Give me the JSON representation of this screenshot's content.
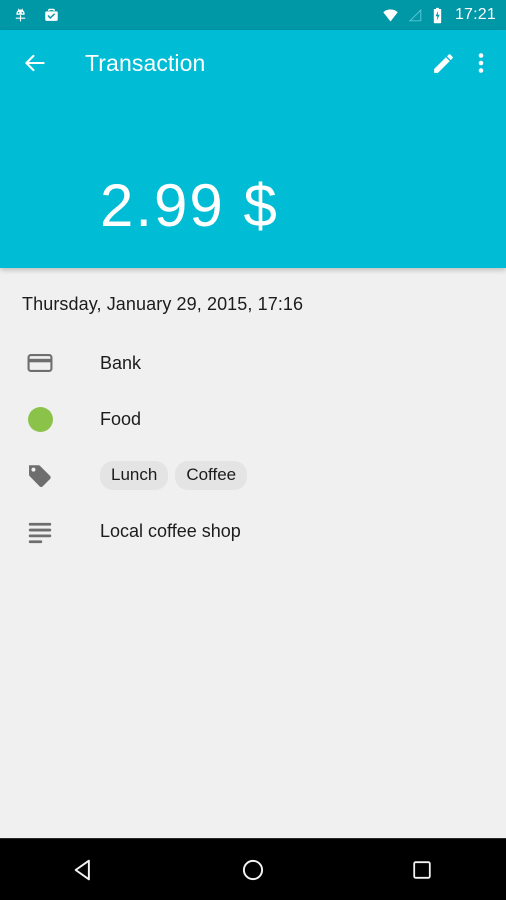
{
  "statusbar": {
    "left_icons": [
      {
        "name": "adb-debug-icon"
      },
      {
        "name": "work-profile-briefcase-icon"
      }
    ],
    "right_icons": [
      {
        "name": "wifi-icon"
      },
      {
        "name": "cellular-signal-icon"
      },
      {
        "name": "battery-charging-icon"
      }
    ],
    "time": "17:21"
  },
  "appbar": {
    "back_icon": "back-arrow-icon",
    "title": "Transaction",
    "edit_icon": "edit-pencil-icon",
    "overflow_icon": "overflow-menu-icon"
  },
  "header": {
    "amount": "2.99 $",
    "background_color": "#00bcd4",
    "statusbar_color": "#0097a7"
  },
  "details": {
    "date": "Thursday, January 29, 2015, 17:16",
    "account": {
      "icon": "credit-card-icon",
      "label": "Bank"
    },
    "category": {
      "icon": "category-color-dot",
      "color": "#8bc34a",
      "label": "Food"
    },
    "tags": {
      "icon": "tag-icon",
      "items": [
        "Lunch",
        "Coffee"
      ]
    },
    "note": {
      "icon": "notes-icon",
      "label": "Local coffee shop"
    }
  },
  "navbar": {
    "back_label": "back-triangle-icon",
    "home_label": "home-circle-icon",
    "recents_label": "recents-square-icon"
  }
}
